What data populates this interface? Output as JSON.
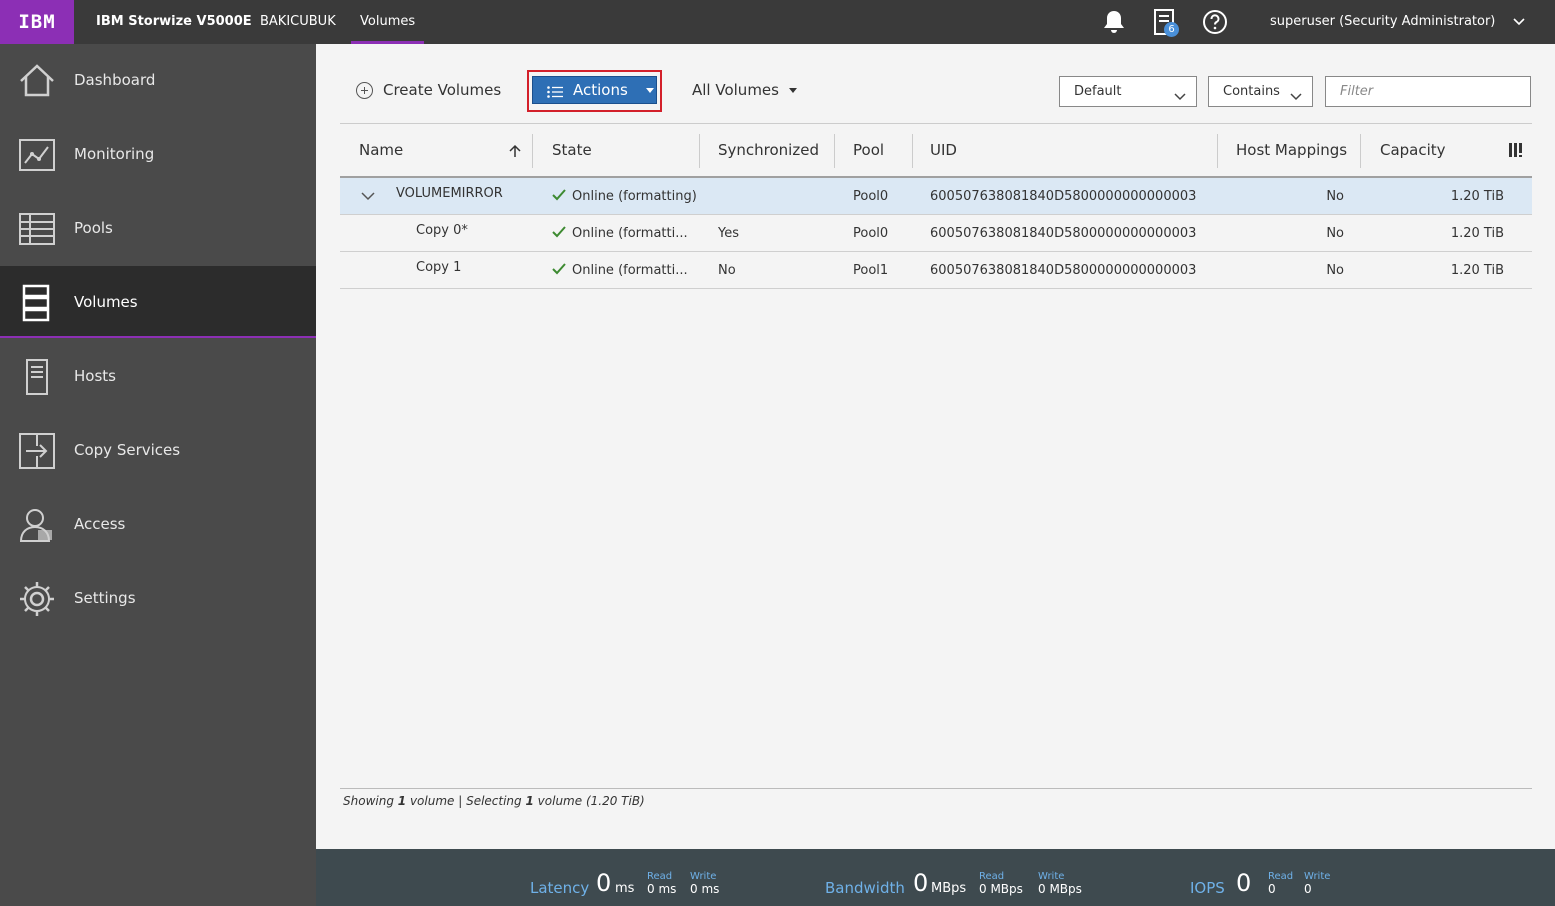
{
  "topbar": {
    "logo": "IBM",
    "product": "IBM Storwize V5000E",
    "system": "BAKICUBUK",
    "page": "Volumes",
    "tasks_badge": "6",
    "user": "superuser (Security Administrator)"
  },
  "sidebar": {
    "items": [
      {
        "label": "Dashboard",
        "icon": "home-icon"
      },
      {
        "label": "Monitoring",
        "icon": "monitoring-icon"
      },
      {
        "label": "Pools",
        "icon": "pools-icon"
      },
      {
        "label": "Volumes",
        "icon": "volumes-icon"
      },
      {
        "label": "Hosts",
        "icon": "hosts-icon"
      },
      {
        "label": "Copy Services",
        "icon": "copy-services-icon"
      },
      {
        "label": "Access",
        "icon": "access-icon"
      },
      {
        "label": "Settings",
        "icon": "settings-icon"
      }
    ],
    "active": "Volumes"
  },
  "toolbar": {
    "create_label": "Create Volumes",
    "actions_label": "Actions",
    "view_label": "All Volumes",
    "filter_mode": "Default",
    "filter_match": "Contains",
    "filter_placeholder": "Filter"
  },
  "table": {
    "columns": [
      "Name",
      "State",
      "Synchronized",
      "Pool",
      "UID",
      "Host Mappings",
      "Capacity"
    ],
    "rows": [
      {
        "name": "VOLUMEMIRROR",
        "state": "Online (formatting)",
        "synchronized": "",
        "pool": "Pool0",
        "uid": "600507638081840D5800000000000003",
        "host_mappings": "No",
        "capacity": "1.20 TiB"
      },
      {
        "name": "Copy 0*",
        "state": "Online (formatti...",
        "synchronized": "Yes",
        "pool": "Pool0",
        "uid": "600507638081840D5800000000000003",
        "host_mappings": "No",
        "capacity": "1.20 TiB"
      },
      {
        "name": "Copy 1",
        "state": "Online (formatti...",
        "synchronized": "No",
        "pool": "Pool1",
        "uid": "600507638081840D5800000000000003",
        "host_mappings": "No",
        "capacity": "1.20 TiB"
      }
    ]
  },
  "footer": {
    "showing_prefix": "Showing",
    "showing_count": "1",
    "showing_mid": "volume | Selecting",
    "selecting_count": "1",
    "selecting_suffix": "volume (1.20 TiB)"
  },
  "status": {
    "latency": {
      "label": "Latency",
      "value": "0",
      "unit": "ms",
      "read_label": "Read",
      "read_value": "0 ms",
      "write_label": "Write",
      "write_value": "0 ms"
    },
    "bandwidth": {
      "label": "Bandwidth",
      "value": "0",
      "unit": "MBps",
      "read_label": "Read",
      "read_value": "0 MBps",
      "write_label": "Write",
      "write_value": "0 MBps"
    },
    "iops": {
      "label": "IOPS",
      "value": "0",
      "read_label": "Read",
      "read_value": "0",
      "write_label": "Write",
      "write_value": "0"
    }
  },
  "colors": {
    "brand": "#8c2fb5",
    "topbar": "#3a3a3a",
    "sidebar": "#4a4a4a",
    "primary_button": "#2e6fb5",
    "highlight_box": "#d3202a",
    "selected_row": "#dbe8f4",
    "status_ok": "#3d8a31"
  }
}
